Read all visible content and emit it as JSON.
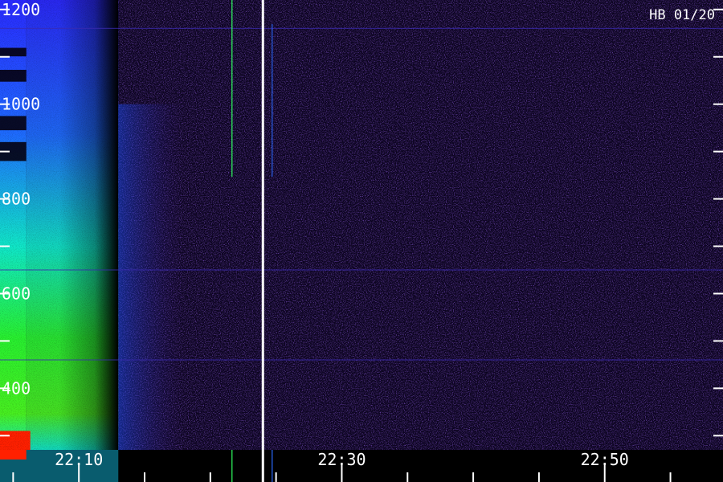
{
  "label": "HB 01/20",
  "chart_data": {
    "type": "heatmap",
    "title": "",
    "xlabel": "",
    "ylabel": "",
    "x_tick_labels": [
      "22:10",
      "22:30",
      "22:50"
    ],
    "y_tick_labels": [
      "400",
      "600",
      "800",
      "1000",
      "1200"
    ],
    "x_range": [
      "22:04",
      "22:59"
    ],
    "y_range": [
      270,
      1220
    ],
    "y_minor_step": 100,
    "x_minor_step_minutes": 5,
    "divider_time": "22:24",
    "colors": {
      "background": "#000000",
      "low": "#3a1a8c",
      "mid": "#1e5aff",
      "high": "#00e0ff",
      "green": "#20ff40",
      "hot": "#ff2000",
      "divider": "#ffffff",
      "ticks": "#ffffff"
    },
    "features": [
      {
        "kind": "broadband-emission",
        "t_start": "22:04",
        "t_end": "22:13",
        "f_low": 270,
        "f_high": 1220
      },
      {
        "kind": "fading-tail",
        "t_start": "22:13",
        "t_end": "22:18",
        "f_low": 270,
        "f_high": 1000
      },
      {
        "kind": "narrowband-line",
        "freq": 650
      },
      {
        "kind": "narrowband-line",
        "freq": 460
      },
      {
        "kind": "narrowband-line",
        "freq": 1160
      }
    ]
  }
}
